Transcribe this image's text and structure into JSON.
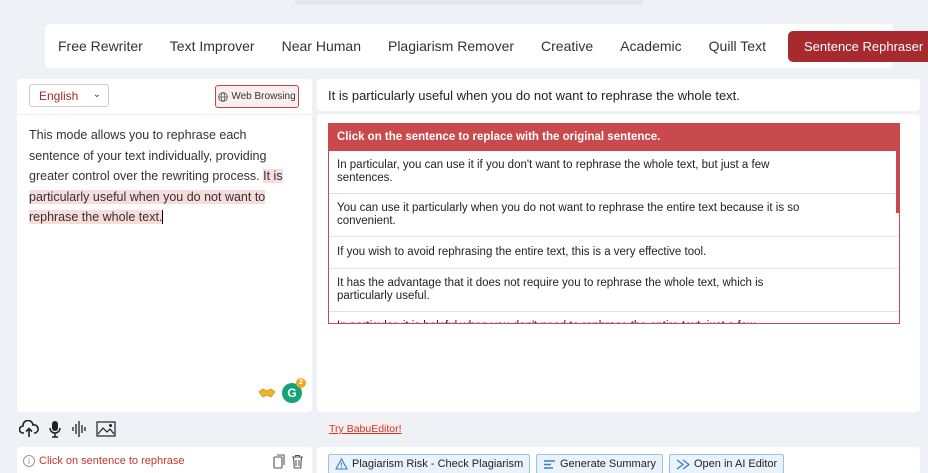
{
  "modes": [
    "Free Rewriter",
    "Text Improver",
    "Near Human",
    "Plagiarism Remover",
    "Creative",
    "Academic",
    "Quill Text"
  ],
  "active_mode": "Sentence Rephraser",
  "language": "English",
  "web_browsing_label": "Web Browsing",
  "input": {
    "plain": "This mode allows you to rephrase each sentence of your text individually, providing greater control over the rewriting process. ",
    "highlighted": "It is particularly useful when you do not want to rephrase the whole text."
  },
  "grammarly_badge": "2",
  "left_footer_message": "Click on sentence to rephrase",
  "selected_sentence": "It is particularly useful when you do not want to rephrase the whole text.",
  "alternatives_header": "Click on the sentence to replace with the original sentence.",
  "alternatives": [
    "In particular, you can use it if you don't want to rephrase the whole text, but just a few sentences.",
    "You can use it particularly when you do not want to rephrase the entire text because it is so convenient.",
    "If you wish to avoid rephrasing the entire text, this is a very effective tool.",
    "It has the advantage that it does not require you to rephrase the whole text, which is particularly useful.",
    "In particular, it is helpful when you don't need to rephrase the entire text, just a few sentences."
  ],
  "try_link": "Try BabuEditor!",
  "actions": {
    "plagiarism": "Plagiarism Risk - Check Plagiarism",
    "summary": "Generate Summary",
    "ai_editor": "Open in AI Editor"
  },
  "colors": {
    "accent": "#a62a2e",
    "panel_header": "#c94a4d",
    "highlight": "#f8dcdc"
  }
}
